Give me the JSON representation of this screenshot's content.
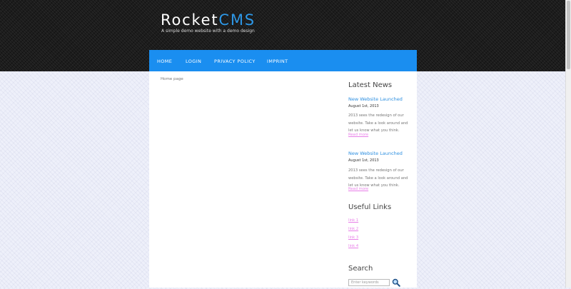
{
  "site": {
    "logo_main": "Rocket",
    "logo_accent": "CMS",
    "tagline": "A simple demo website with a demo design",
    "accent_color": "#1a8ef0"
  },
  "nav": {
    "items": [
      {
        "label": "HOME"
      },
      {
        "label": "LOGIN"
      },
      {
        "label": "PRIVACY POLICY"
      },
      {
        "label": "IMPRINT"
      }
    ]
  },
  "main": {
    "breadcrumb": "Home page"
  },
  "sidebar": {
    "news_heading": "Latest News",
    "news": [
      {
        "title": "New Website Launched",
        "date": "August 1st, 2013",
        "body": "2013 sees the redesign of our website. Take a look around and let us know what you think.",
        "read_more": "Read more"
      },
      {
        "title": "New Website Launched",
        "date": "August 1st, 2013",
        "body": "2013 sees the redesign of our website. Take a look around and let us know what you think.",
        "read_more": "Read more"
      }
    ],
    "links_heading": "Useful Links",
    "links": [
      {
        "label": "link 1"
      },
      {
        "label": "link 2"
      },
      {
        "label": "link 3"
      },
      {
        "label": "link 4"
      }
    ],
    "search_heading": "Search",
    "search_placeholder": "Enter keywords",
    "search_icon": "magnifier-icon"
  }
}
